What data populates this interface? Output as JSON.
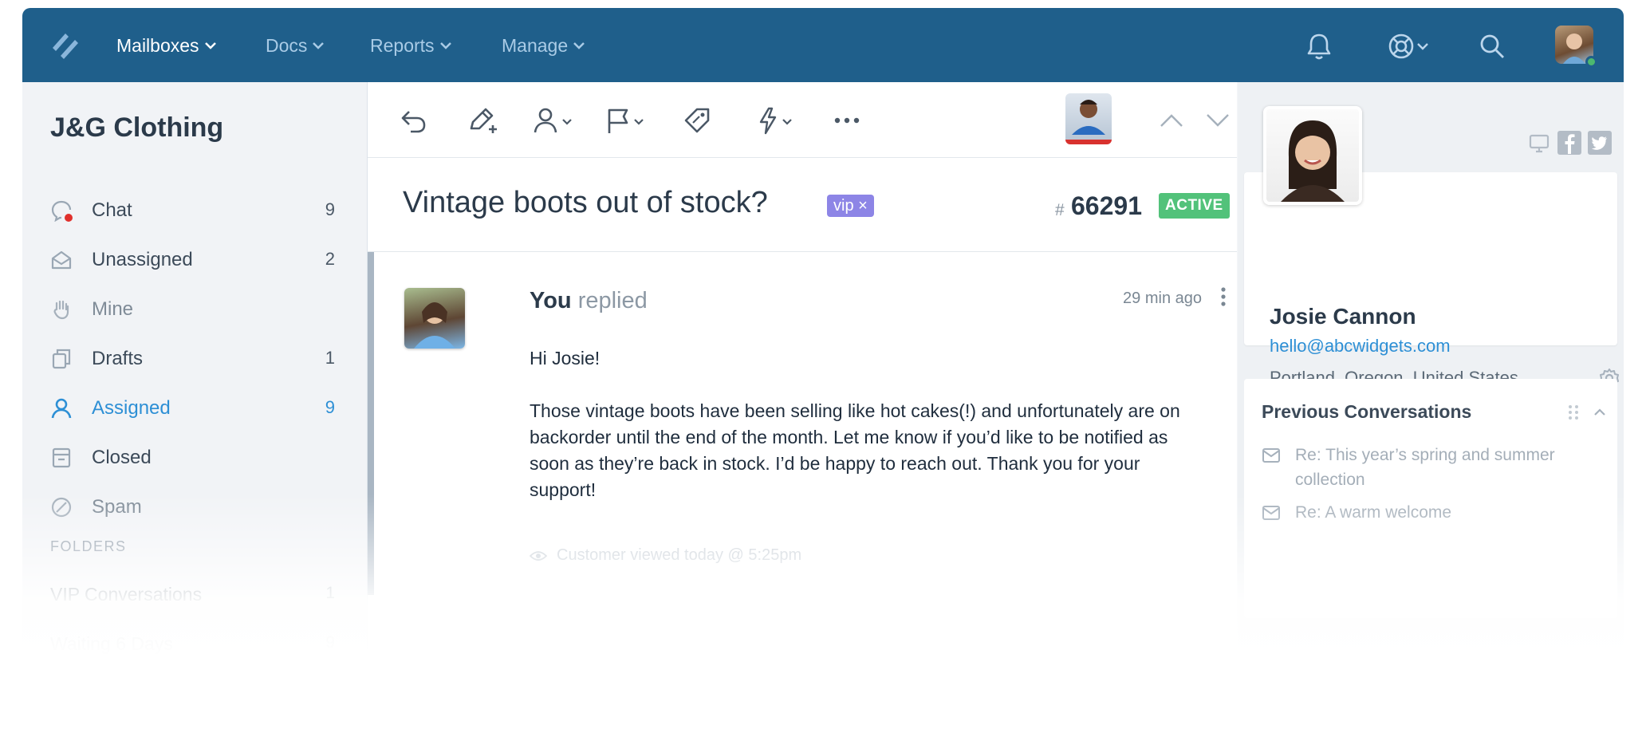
{
  "nav": {
    "items": [
      {
        "label": "Mailboxes",
        "active": true
      },
      {
        "label": "Docs",
        "active": false
      },
      {
        "label": "Reports",
        "active": false
      },
      {
        "label": "Manage",
        "active": false
      }
    ],
    "icons": [
      "bell-icon",
      "help-icon",
      "search-icon"
    ],
    "user_status": "online"
  },
  "sidebar": {
    "mailbox_name": "J&G Clothing",
    "items": [
      {
        "label": "Chat",
        "count": "9",
        "icon": "chat-icon"
      },
      {
        "label": "Unassigned",
        "count": "2",
        "icon": "inbox-icon"
      },
      {
        "label": "Mine",
        "count": "",
        "icon": "hand-icon"
      },
      {
        "label": "Drafts",
        "count": "1",
        "icon": "drafts-icon"
      },
      {
        "label": "Assigned",
        "count": "9",
        "icon": "user-icon",
        "active": true
      },
      {
        "label": "Closed",
        "count": "",
        "icon": "archive-icon"
      },
      {
        "label": "Spam",
        "count": "",
        "icon": "spam-icon"
      }
    ],
    "folders_header": "FOLDERS",
    "folders": [
      {
        "label": "VIP Conversations",
        "count": "1"
      },
      {
        "label": "Waiting 6 Days",
        "count": "9"
      }
    ]
  },
  "toolbar": {
    "actions": [
      "reply-icon",
      "note-icon",
      "assign-icon",
      "status-flag-icon",
      "tag-icon",
      "workflow-icon",
      "more-icon"
    ]
  },
  "conversation": {
    "subject": "Vintage boots out of stock?",
    "tag": "vip ×",
    "hash": "#",
    "number": "66291",
    "status": "ACTIVE"
  },
  "message": {
    "author": "You",
    "action": "replied",
    "time": "29 min ago",
    "greeting": "Hi Josie!",
    "body": "Those vintage boots have been selling like hot cakes(!) and unfortunately are on backorder until the end of the month. Let me know if you’d like to be notified as soon as they’re back in stock. I’d be happy to reach out. Thank you for your support!",
    "viewed": "Customer viewed today @ 5:25pm"
  },
  "customer": {
    "name": "Josie Cannon",
    "email": "hello@abcwidgets.com",
    "location": "Portland, Oregon, United States"
  },
  "previous": {
    "title": "Previous Conversations",
    "items": [
      "Re: This year’s spring and summer collection",
      "Re: A warm welcome"
    ]
  },
  "colors": {
    "nav_bg": "#1f5f8b",
    "accent": "#2d8fd5",
    "vip_tag": "#8d85e6",
    "active_badge": "#52c27a",
    "unread_dot": "#e0302c"
  }
}
